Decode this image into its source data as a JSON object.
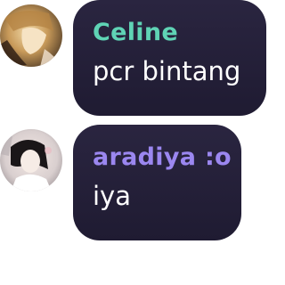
{
  "messages": [
    {
      "avatar": "user-avatar-photo",
      "sender": "Celine",
      "sender_color": "#5fd3b5",
      "text": "pcr bintang"
    },
    {
      "avatar": "user-avatar-photo",
      "sender": "aradiya :o",
      "sender_color": "#9b87f0",
      "text": "iya"
    }
  ]
}
